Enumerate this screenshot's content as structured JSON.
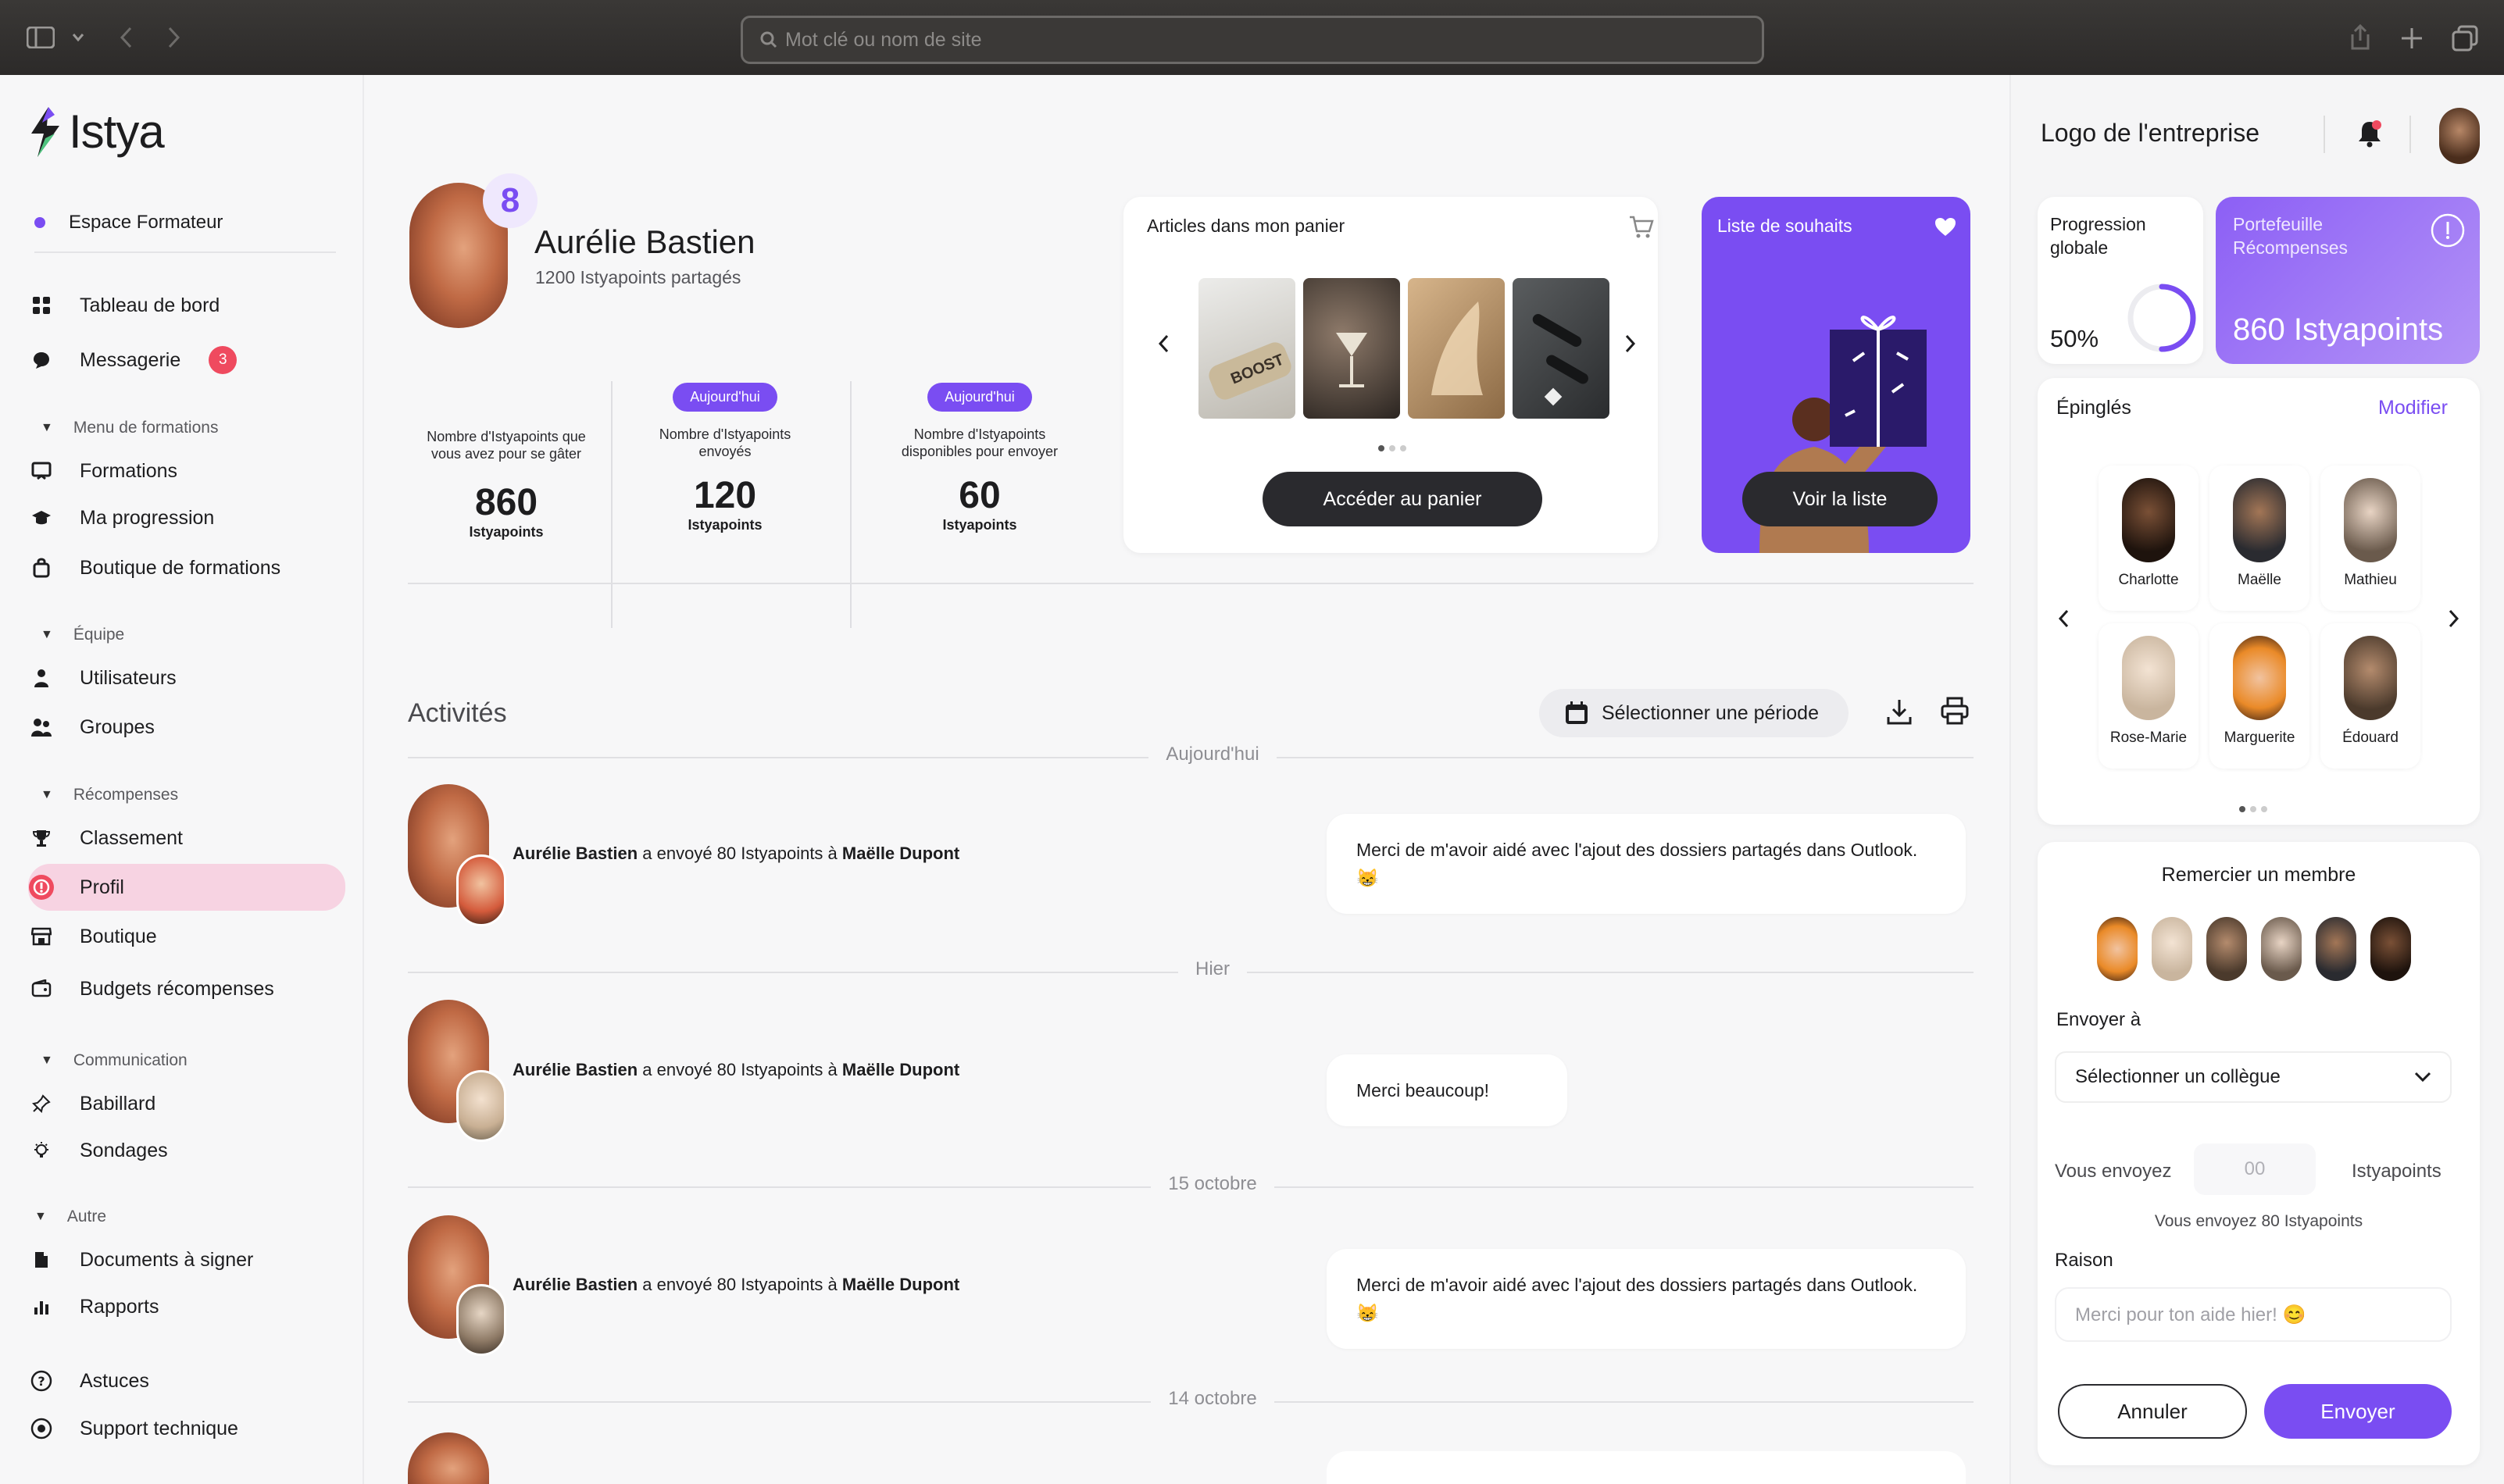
{
  "browser": {
    "url_placeholder": "Mot clé ou nom de site"
  },
  "brand": {
    "name": "Istya",
    "accent": "#7a4df2",
    "pink": "#f7d3e2",
    "badge_red": "#ef4a5f"
  },
  "sidebar": {
    "espace": "Espace Formateur",
    "items_top": [
      {
        "label": "Tableau de bord",
        "icon": "grid-icon"
      },
      {
        "label": "Messagerie",
        "icon": "chat-icon",
        "badge": "3"
      }
    ],
    "sections": [
      {
        "title": "Menu de formations",
        "items": [
          "Formations",
          "Ma progression",
          "Boutique de formations"
        ]
      },
      {
        "title": "Équipe",
        "items": [
          "Utilisateurs",
          "Groupes"
        ]
      },
      {
        "title": "Récompenses",
        "items": [
          "Classement",
          "Profil",
          "Boutique",
          "Budgets récompenses"
        ]
      },
      {
        "title": "Communication",
        "items": [
          "Babillard",
          "Sondages"
        ]
      },
      {
        "title": "Autre",
        "items": [
          "Documents à signer",
          "Rapports"
        ]
      }
    ],
    "bottom": [
      "Astuces",
      "Support technique"
    ],
    "active": "Profil"
  },
  "profile": {
    "name": "Aurélie Bastien",
    "level": "8",
    "subtitle": "1200 Istyapoints partagés",
    "stats": [
      {
        "label": "Nombre d'Istyapoints que vous avez pour se gâter",
        "value": "860",
        "unit": "Istyapoints",
        "pill": ""
      },
      {
        "label": "Nombre d'Istyapoints envoyés",
        "value": "120",
        "unit": "Istyapoints",
        "pill": "Aujourd'hui"
      },
      {
        "label": "Nombre d'Istyapoints disponibles pour envoyer",
        "value": "60",
        "unit": "Istyapoints",
        "pill": "Aujourd'hui"
      }
    ]
  },
  "cart": {
    "title": "Articles dans mon panier",
    "button": "Accéder au panier",
    "item_text": "BOOST"
  },
  "wishlist": {
    "title": "Liste de souhaits",
    "button": "Voir la liste"
  },
  "activities": {
    "title": "Activités",
    "period_button": "Sélectionner une période",
    "groups": [
      {
        "date": "Aujourd'hui",
        "sender": "Aurélie Bastien",
        "mid": " a envoyé 80 Istyapoints à ",
        "recipient": "Maëlle Dupont",
        "message": "Merci de m'avoir aidé avec l'ajout des dossiers partagés dans Outlook. 😸"
      },
      {
        "date": "Hier",
        "sender": "Aurélie Bastien",
        "mid": " a envoyé 80 Istyapoints à ",
        "recipient": "Maëlle Dupont",
        "message": "Merci beaucoup!"
      },
      {
        "date": "15 octobre",
        "sender": "Aurélie Bastien",
        "mid": " a envoyé 80 Istyapoints à ",
        "recipient": "Maëlle Dupont",
        "message": "Merci de m'avoir aidé avec l'ajout des dossiers partagés dans Outlook. 😸"
      },
      {
        "date": "14 octobre"
      }
    ]
  },
  "right": {
    "company_logo": "Logo de l'entreprise",
    "progress": {
      "label": "Progression globale",
      "value": "50%",
      "fraction": 0.5
    },
    "wallet": {
      "label": "Portefeuille Récompenses",
      "value": "860 Istyapoints"
    },
    "pinned": {
      "title": "Épinglés",
      "edit": "Modifier",
      "people": [
        "Charlotte",
        "Maëlle",
        "Mathieu",
        "Rose-Marie",
        "Marguerite",
        "Édouard"
      ]
    },
    "thank": {
      "title": "Remercier un membre",
      "send_to": "Envoyer à",
      "select": "Sélectionner un collègue",
      "you_send": "Vous envoyez",
      "amount_placeholder": "00",
      "unit": "Istyapoints",
      "summary": "Vous envoyez 80 Istyapoints",
      "reason": "Raison",
      "reason_placeholder": "Merci pour ton aide hier! 😊",
      "cancel": "Annuler",
      "send": "Envoyer"
    }
  }
}
